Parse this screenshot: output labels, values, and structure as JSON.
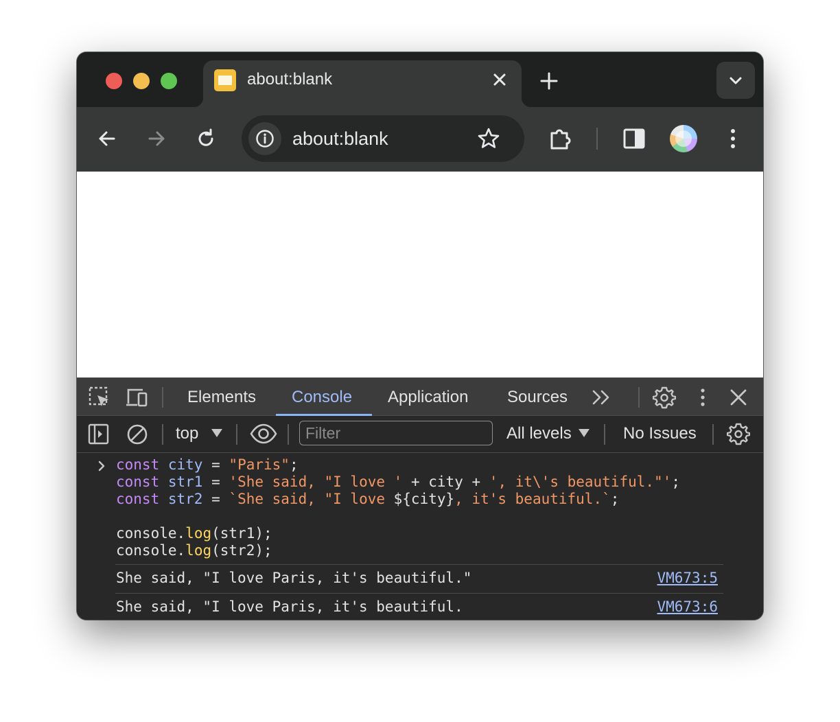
{
  "browser": {
    "tab": {
      "title": "about:blank"
    },
    "omnibox": {
      "url": "about:blank"
    }
  },
  "devtools": {
    "tabs": [
      {
        "label": "Elements",
        "active": false
      },
      {
        "label": "Console",
        "active": true
      },
      {
        "label": "Application",
        "active": false
      },
      {
        "label": "Sources",
        "active": false
      }
    ],
    "toolbar": {
      "context": "top",
      "filter_placeholder": "Filter",
      "levels": "All levels",
      "issues": "No Issues"
    },
    "console": {
      "input_lines": [
        "const city = \"Paris\";",
        "const str1 = 'She said, \"I love ' + city + ', it\\'s beautiful.\"';",
        "const str2 = `She said, \"I love ${city}, it's beautiful.`;",
        "",
        "console.log(str1);",
        "console.log(str2);"
      ],
      "outputs": [
        {
          "text": "She said, \"I love Paris, it's beautiful.\"",
          "source": "VM673:5"
        },
        {
          "text": "She said, \"I love Paris, it's beautiful.",
          "source": "VM673:6"
        }
      ]
    }
  },
  "colors": {
    "accent": "#8ab4f8",
    "keyword": "#c58af9",
    "variable": "#9fbcf8",
    "string": "#f29766",
    "function": "#ffd75f"
  }
}
